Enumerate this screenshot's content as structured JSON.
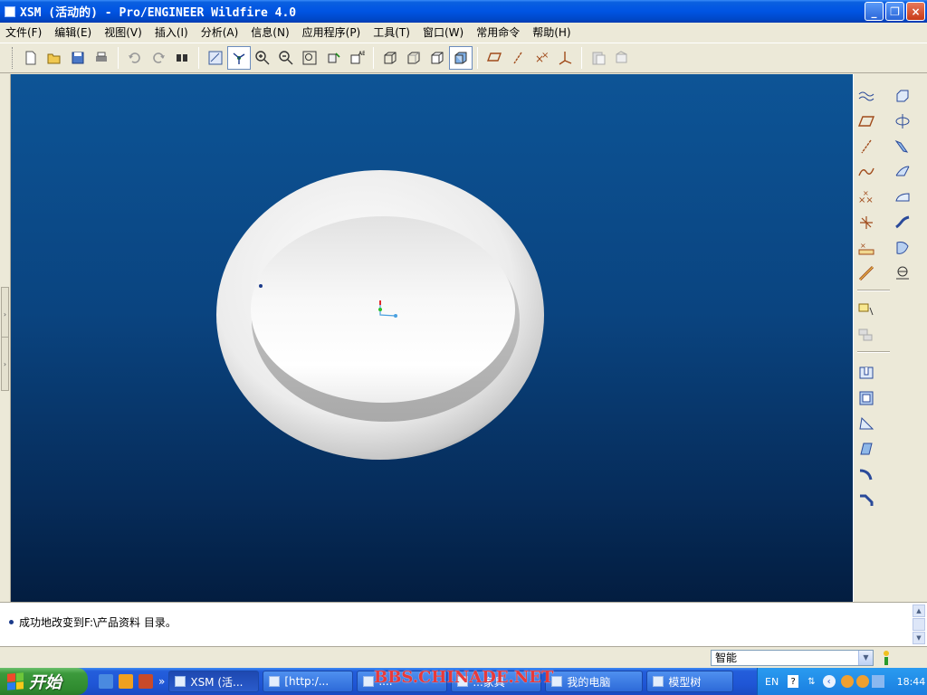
{
  "window": {
    "title": "XSM (活动的) - Pro/ENGINEER Wildfire 4.0",
    "minimize_label": "_",
    "maximize_label": "❐",
    "close_label": "×"
  },
  "menu": {
    "items": [
      "文件(F)",
      "编辑(E)",
      "视图(V)",
      "插入(I)",
      "分析(A)",
      "信息(N)",
      "应用程序(P)",
      "工具(T)",
      "窗口(W)",
      "常用命令",
      "帮助(H)"
    ]
  },
  "toolbar": {
    "icons": [
      "new-icon",
      "open-icon",
      "save-icon",
      "print-icon",
      "undo-icon",
      "redo-icon",
      "find-icon",
      "repaint-icon",
      "spin-center-icon",
      "zoom-in-icon",
      "zoom-out-icon",
      "refit-icon",
      "orient-icon",
      "saved-views-icon",
      "wireframe-icon",
      "hidden-line-icon",
      "no-hidden-icon",
      "shading-icon",
      "datum-planes-icon",
      "datum-axes-icon",
      "datum-points-icon",
      "coord-systems-icon",
      "paste-icon",
      "paste-special-icon"
    ]
  },
  "leftrail": {
    "tab1_label": "›",
    "tab2_label": "›"
  },
  "status": {
    "message": "成功地改变到F:\\产品资料 目录。",
    "filter_value": "智能"
  },
  "taskbar": {
    "start_label": "开始",
    "more_label": "»",
    "buttons": [
      {
        "label": "XSM (活..."
      },
      {
        "label": "[http:/..."
      },
      {
        "label": "...."
      },
      {
        "label": "...家具"
      },
      {
        "label": "我的电脑"
      },
      {
        "label": "模型树"
      }
    ],
    "language": "EN",
    "clock": "18:44"
  },
  "watermark": "BBS.CHINADE.NET",
  "colors": {
    "viewport_top": "#0d5496",
    "viewport_bottom": "#031d40",
    "part_shade": "#e8e8e8",
    "titlebar": "#0054e3"
  }
}
